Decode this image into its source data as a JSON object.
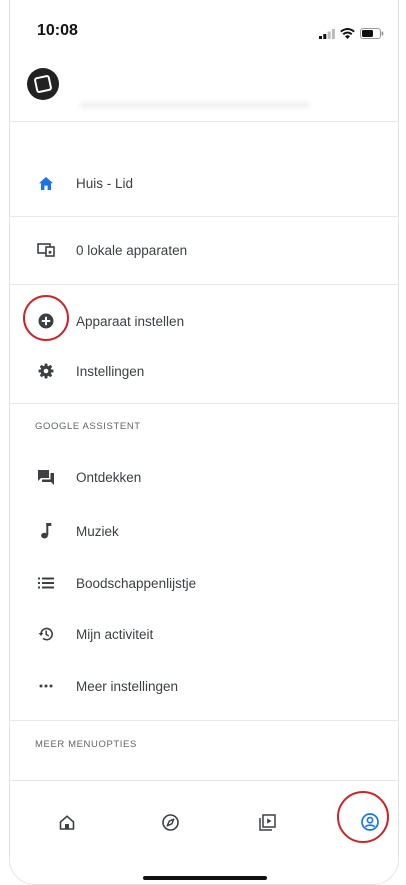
{
  "status_bar": {
    "time": "10:08",
    "icons": [
      "signal-icon",
      "wifi-icon",
      "battery-icon"
    ]
  },
  "header": {
    "logo_icon": "google-home-logo"
  },
  "menu": {
    "home_item": {
      "label": "Huis - Lid",
      "icon": "home-icon"
    },
    "local_devices": {
      "label": "0 lokale apparaten",
      "icon": "devices-icon"
    },
    "setup_device": {
      "label": "Apparaat instellen",
      "icon": "add-circle-icon"
    },
    "settings": {
      "label": "Instellingen",
      "icon": "gear-icon"
    },
    "assistant_section": "GOOGLE ASSISTENT",
    "discover": {
      "label": "Ontdekken",
      "icon": "chat-icon"
    },
    "music": {
      "label": "Muziek",
      "icon": "music-note-icon"
    },
    "shopping_list": {
      "label": "Boodschappenlijstje",
      "icon": "list-icon"
    },
    "activity": {
      "label": "Mijn activiteit",
      "icon": "history-icon"
    },
    "more_settings": {
      "label": "Meer instellingen",
      "icon": "more-horizontal-icon"
    },
    "more_section": "MEER MENUOPTIES"
  },
  "bottom_nav": {
    "items": [
      "home-tab-icon",
      "discover-tab-icon",
      "media-tab-icon",
      "account-tab-icon"
    ],
    "active": "account-tab-icon"
  },
  "colors": {
    "accent_blue": "#1a73e8",
    "highlight_red": "#c8262a",
    "icon_dark": "#3c4043"
  }
}
